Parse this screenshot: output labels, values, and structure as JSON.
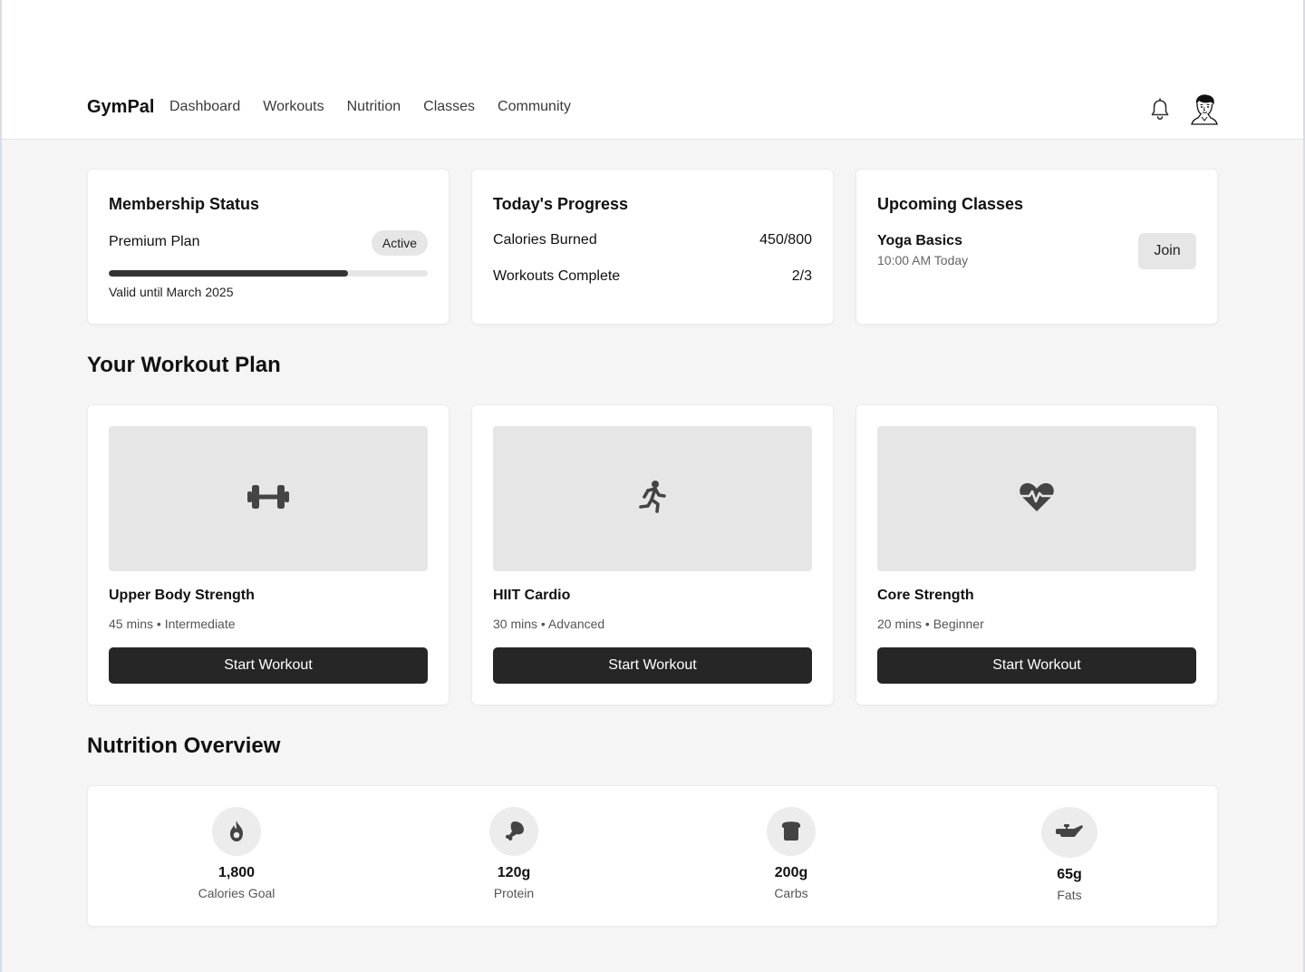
{
  "brand": "GymPal",
  "nav": [
    "Dashboard",
    "Workouts",
    "Nutrition",
    "Classes",
    "Community"
  ],
  "icons": {
    "notifications": "bell-icon",
    "profile": "avatar"
  },
  "membership": {
    "title": "Membership Status",
    "plan": "Premium Plan",
    "badge": "Active",
    "progress": 0.75,
    "valid": "Valid until March 2025"
  },
  "progress": {
    "title": "Today's Progress",
    "rows": [
      {
        "label": "Calories Burned",
        "value": "450/800"
      },
      {
        "label": "Workouts Complete",
        "value": "2/3"
      }
    ]
  },
  "classes": {
    "title": "Upcoming Classes",
    "items": [
      {
        "name": "Yoga Basics",
        "time": "10:00 AM Today",
        "button": "Join"
      }
    ]
  },
  "workout_plan": {
    "title": "Your Workout Plan",
    "cards": [
      {
        "title": "Upper Body Strength",
        "meta": "45 mins • Intermediate",
        "button": "Start Workout",
        "icon": "dumbbell-icon"
      },
      {
        "title": "HIIT Cardio",
        "meta": "30 mins • Advanced",
        "button": "Start Workout",
        "icon": "running-icon"
      },
      {
        "title": "Core Strength",
        "meta": "20 mins • Beginner",
        "button": "Start Workout",
        "icon": "heartbeat-icon"
      }
    ]
  },
  "nutrition": {
    "title": "Nutrition Overview",
    "items": [
      {
        "value": "1,800",
        "label": "Calories Goal",
        "icon": "fire-icon"
      },
      {
        "value": "120g",
        "label": "Protein",
        "icon": "drumstick-icon"
      },
      {
        "value": "200g",
        "label": "Carbs",
        "icon": "bread-icon"
      },
      {
        "value": "65g",
        "label": "Fats",
        "icon": "oil-can-icon"
      }
    ]
  }
}
